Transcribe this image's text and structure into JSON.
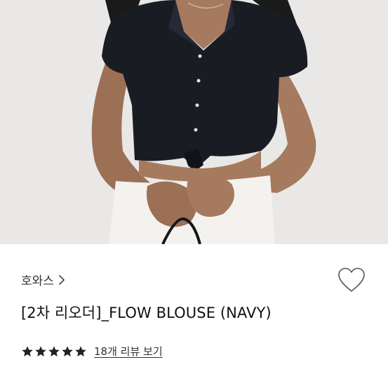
{
  "product": {
    "brand": "호와스",
    "title": "[2차 리오더]_FLOW BLOUSE (NAVY)",
    "rating": 5,
    "review_link": "18개 리뷰 보기"
  },
  "icons": {
    "brand_chevron": "chevron-right-icon",
    "wishlist": "heart-outline-icon",
    "star": "star-icon"
  },
  "colors": {
    "star": "#222222",
    "blouse": "#1a1c24",
    "skirt": "#f3f2ef"
  }
}
